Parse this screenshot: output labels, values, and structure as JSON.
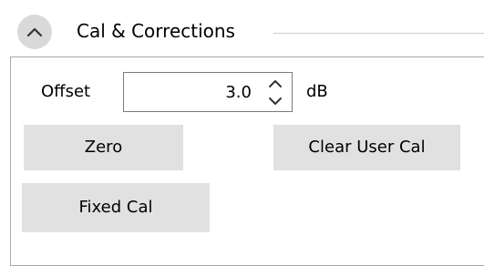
{
  "section": {
    "title": "Cal & Corrections",
    "collapse_icon": "chevron-up-icon"
  },
  "offset": {
    "label": "Offset",
    "value": "3.0",
    "unit": "dB",
    "increment_icon": "chevron-up-icon",
    "decrement_icon": "chevron-down-icon"
  },
  "buttons": {
    "zero": "Zero",
    "clear_user_cal": "Clear User Cal",
    "fixed_cal": "Fixed Cal"
  },
  "colors": {
    "button_background": "#e1e1e1",
    "toggle_background": "#d9d9d9",
    "panel_border": "#a9a9a9"
  }
}
